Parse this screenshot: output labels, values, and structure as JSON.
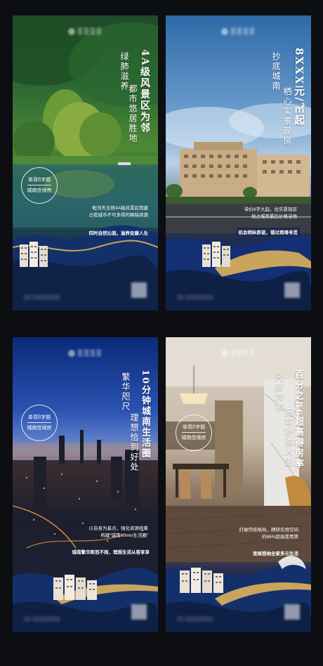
{
  "posters": [
    {
      "title": "4A级风景区为邻",
      "subtitle_lines": [
        "绿肺滋养",
        "都市悠居胜地"
      ],
      "seal_lines": [
        "单项8字题",
        "城南佳境房"
      ],
      "desc_lines": [
        "毗邻天生桥4A级风景区而建",
        "占揽城市不可多得的稀缺资源"
      ],
      "tag": "四时自然沁润，滋养安康人生"
    },
    {
      "title": "8XXX元/㎡起",
      "subtitle_lines": [
        "抄底城南",
        "栖心实景现房"
      ],
      "seal_lines": [
        "单项8字题",
        "城南佳境房"
      ],
      "desc_lines": [
        "单价8字大起，住实景现房",
        "抢占城南最后价格洼地"
      ],
      "tag": "机会稍纵即逝，错过再难寻觅"
    },
    {
      "title": "10分钟城南生活圈",
      "subtitle_lines": [
        "繁华咫尺",
        "理想恰到好处"
      ],
      "seal_lines": [
        "单项8字题",
        "城南佳境房"
      ],
      "desc_lines": [
        "以自身为基点，强化资源统筹",
        "构建“城南10min生活圈”"
      ],
      "tag": "城南繁华距而不闹，理想生活从容享享"
    },
    {
      "title": "百分之86超高得房率",
      "subtitle_lines": [
        "尺度为笔",
        "拓写舒适人生"
      ],
      "seal_lines": [
        "单项8字题",
        "城南佳境房"
      ],
      "desc_lines": [
        "打破传统格局，精研实用空间",
        "约86%超高使用率"
      ],
      "tag": "宽裕容纳全家多元生活"
    }
  ],
  "colors": {
    "gold": "#c9a45c",
    "navy": "#0f2349",
    "background": "#0d0e12"
  },
  "icons": [
    "logo-mark-icon",
    "qr-code-icon"
  ]
}
